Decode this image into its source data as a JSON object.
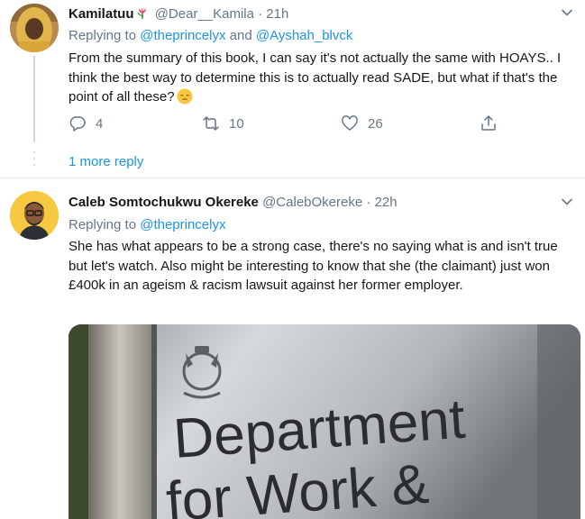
{
  "tweets": [
    {
      "display_name": "Kamilatuu",
      "handle": "@Dear__Kamila",
      "time": "· 21h",
      "replying_prefix": "Replying to",
      "replying_to_1": "@theprincelyx",
      "replying_and": "and",
      "replying_to_2": "@Ayshah_blvck",
      "text": "From the summary of this book, I can say it's not actually the same with HOAYS.. I think the best way to determine this is to actually read SADE, but what if that's the point of all these?",
      "reply_count": "4",
      "retweet_count": "10",
      "like_count": "26"
    },
    {
      "display_name": "Caleb Somtochukwu Okereke",
      "handle": "@CalebOkereke",
      "time": "· 22h",
      "replying_prefix": "Replying to",
      "replying_to_1": "@theprincelyx",
      "text": "She has what appears to be a strong case, there's no saying what is and isn't true but let's watch. Also might be interesting to know that she (the claimant) just won £400k in an ageism & racism lawsuit against her former employer.",
      "image_sign_line1": "Department",
      "image_sign_line2": "for Work &"
    }
  ],
  "more_replies": "1 more reply",
  "colors": {
    "link": "#1b95e0",
    "muted": "#657786",
    "divider": "#e6ecf0"
  },
  "icons": [
    "reply-icon",
    "retweet-icon",
    "like-icon",
    "share-icon",
    "caret-down-icon",
    "tulip-emoji",
    "pensive-emoji"
  ]
}
